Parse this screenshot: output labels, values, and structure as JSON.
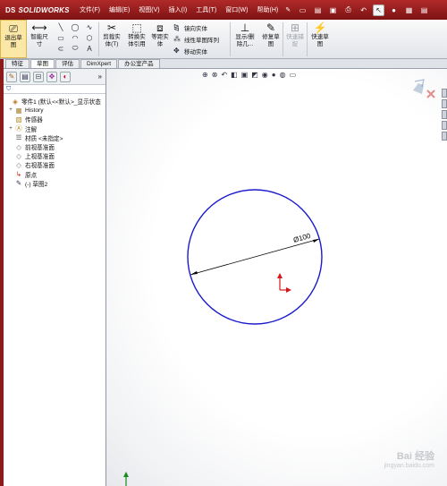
{
  "app": {
    "brand_prefix": "DS",
    "brand": "SOLIDWORKS"
  },
  "menus": [
    "文件(F)",
    "编辑(E)",
    "视图(V)",
    "插入(I)",
    "工具(T)",
    "窗口(W)",
    "帮助(H)"
  ],
  "ribbon": {
    "exit_sketch": "退出草\n图",
    "smart_dim": "智能尺\n寸",
    "trim": "剪裁实\n体(T)",
    "convert": "转换实\n体引用",
    "offset": "等距实\n体",
    "mirror": "镜向实体",
    "linear_pattern": "线性草图阵列",
    "move": "移动实体",
    "show_delete": "显示/删\n除几...",
    "repair": "修复草\n图",
    "quick_snap": "快速捕\n捉",
    "rapid_sketch": "快速草\n图"
  },
  "tabs": [
    "特征",
    "草图",
    "评估",
    "DimXpert",
    "办公室产品"
  ],
  "tree": [
    {
      "label": "零件1 (默认<<默认>_显示状态",
      "icon": "part-icon",
      "exp": ""
    },
    {
      "label": "History",
      "icon": "history-icon",
      "exp": "+"
    },
    {
      "label": "传感器",
      "icon": "sensor-icon",
      "exp": ""
    },
    {
      "label": "注解",
      "icon": "annotation-icon",
      "exp": "+"
    },
    {
      "label": "材质 <未指定>",
      "icon": "material-icon",
      "exp": ""
    },
    {
      "label": "前视基准面",
      "icon": "plane-icon",
      "exp": ""
    },
    {
      "label": "上视基准面",
      "icon": "plane-icon",
      "exp": ""
    },
    {
      "label": "右视基准面",
      "icon": "plane-icon",
      "exp": ""
    },
    {
      "label": "原点",
      "icon": "origin-icon",
      "exp": ""
    },
    {
      "label": "(-) 草图2",
      "icon": "sketch-icon",
      "exp": ""
    }
  ],
  "sketch": {
    "dimension_label": "Ø100",
    "diameter": 100
  },
  "watermark": {
    "line1": "Bai 经验",
    "line2": "jingyan.baidu.com"
  },
  "colors": {
    "title_bar": "#9a1f1f",
    "circle": "#1a1acd",
    "origin": "#d11a1a"
  }
}
